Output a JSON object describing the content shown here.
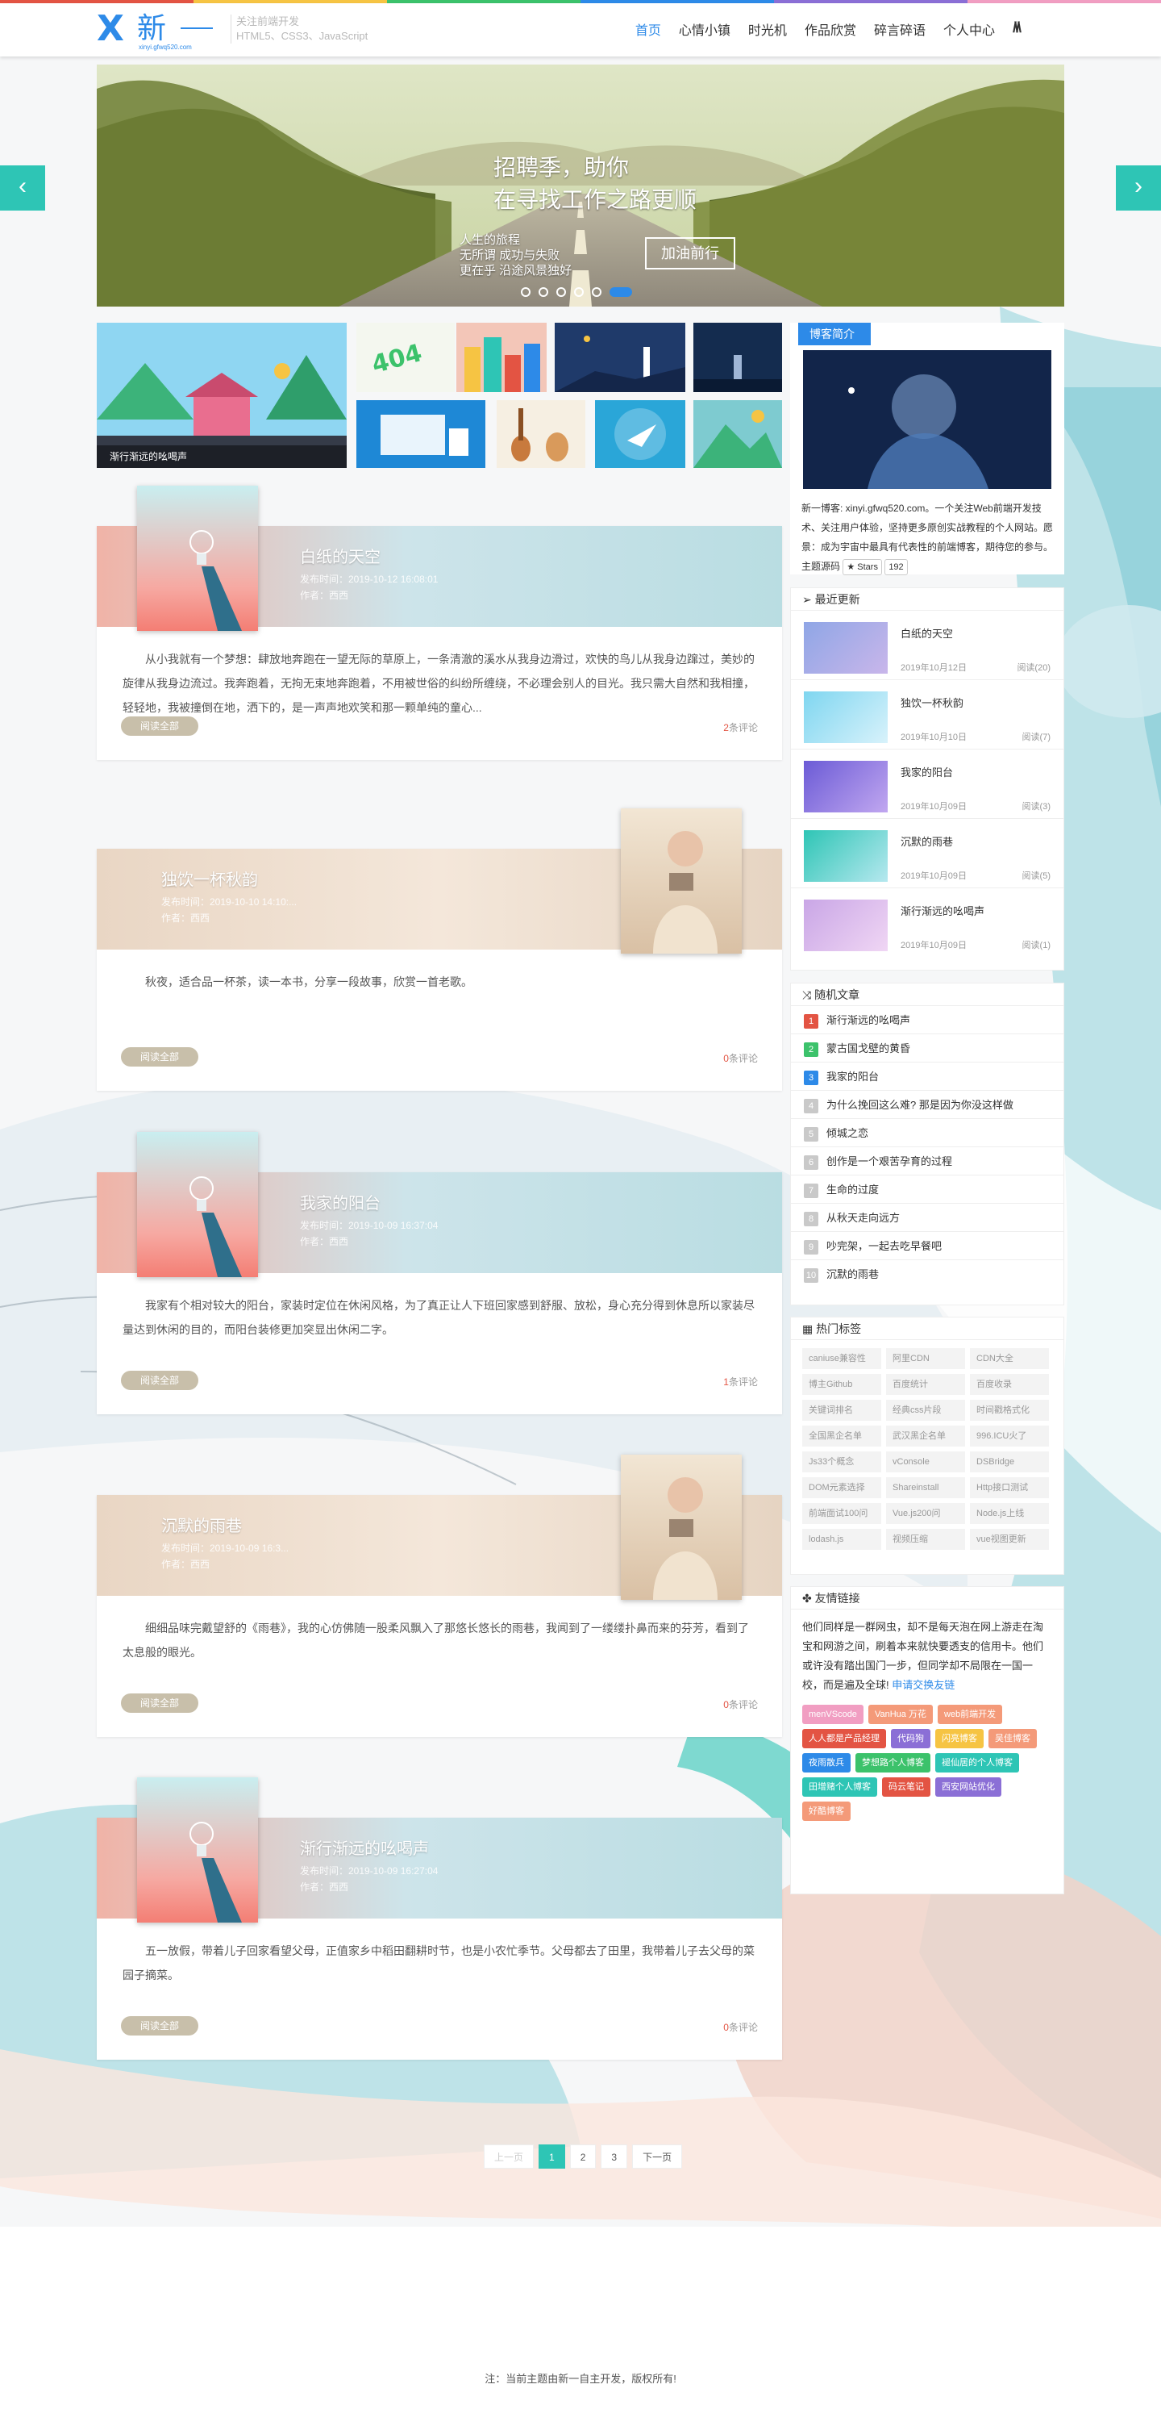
{
  "colors": {
    "accent": "#2d8ae8",
    "teal": "#2ec5b5",
    "comment_red": "#e35443"
  },
  "header": {
    "logo_x": "X",
    "logo_text": "新",
    "logo_domain": "xinyi.gfwq520.com",
    "slogan_line1": "关注前端开发",
    "slogan_line2": "HTML5、CSS3、JavaScript",
    "nav": [
      {
        "label": "首页",
        "active": true
      },
      {
        "label": "心情小镇",
        "active": false
      },
      {
        "label": "时光机",
        "active": false
      },
      {
        "label": "作品欣赏",
        "active": false
      },
      {
        "label": "碎言碎语",
        "active": false
      },
      {
        "label": "个人中心",
        "active": false
      }
    ],
    "menu_icon": "mountain-menu-icon"
  },
  "banner": {
    "headline1": "招聘季，助你",
    "headline2": "在寻找工作之路更顺",
    "sub1": "人生的旅程",
    "sub2": "无所谓 成功与失败",
    "sub3": "更在乎 沿途风景独好",
    "button": "加油前行",
    "prev": "‹",
    "next": "›",
    "slides": 6,
    "active_slide": 6
  },
  "thumbs": {
    "caption": "渐行渐远的吆喝声"
  },
  "posts": [
    {
      "title": "白纸的天空",
      "date": "发布时间：2019-10-12 16:08:01",
      "author": "作者：西西",
      "excerpt": "从小我就有一个梦想：肆放地奔跑在一望无际的草原上，一条清澈的溪水从我身边滑过，欢快的鸟儿从我身边蹿过，美妙的旋律从我身边流过。我奔跑着，无拘无束地奔跑着，不用被世俗的纠纷所缠绕，不必理会别人的目光。我只需大自然和我相撞，轻轻地，我被撞倒在地，洒下的，是一声声地欢笑和那一颗单纯的童心...",
      "read": "阅读全部",
      "comments": "2",
      "comments_label": "条评论"
    },
    {
      "title": "独饮一杯秋韵",
      "date": "发布时间：2019-10-10 14:10:...",
      "author": "作者：西西",
      "excerpt": "秋夜，适合品一杯茶，读一本书，分享一段故事，欣赏一首老歌。",
      "read": "阅读全部",
      "comments": "0",
      "comments_label": "条评论"
    },
    {
      "title": "我家的阳台",
      "date": "发布时间：2019-10-09 16:37:04",
      "author": "作者：西西",
      "excerpt": "我家有个相对较大的阳台，家装时定位在休闲风格，为了真正让人下班回家感到舒服、放松，身心充分得到休息所以家装尽量达到休闲的目的，而阳台装修更加突显出休闲二字。",
      "read": "阅读全部",
      "comments": "1",
      "comments_label": "条评论"
    },
    {
      "title": "沉默的雨巷",
      "date": "发布时间：2019-10-09 16:3...",
      "author": "作者：西西",
      "excerpt": "细细品味完戴望舒的《雨巷》，我的心仿佛随一股柔风飘入了那悠长悠长的雨巷，我闻到了一缕缕扑鼻而来的芬芳，看到了太息般的眼光。",
      "read": "阅读全部",
      "comments": "0",
      "comments_label": "条评论"
    },
    {
      "title": "渐行渐远的吆喝声",
      "date": "发布时间：2019-10-09 16:27:04",
      "author": "作者：西西",
      "excerpt": "五一放假，带着儿子回家看望父母，正值家乡中稻田翻耕时节，也是小农忙季节。父母都去了田里，我带着儿子去父母的菜园子摘菜。",
      "read": "阅读全部",
      "comments": "0",
      "comments_label": "条评论"
    }
  ],
  "sidebar": {
    "intro": {
      "title": "博客简介",
      "text": "新一博客: xinyi.gfwq520.com。一个关注Web前端开发技术、关注用户体验，坚持更多原创实战教程的个人网站。愿景：成为宇宙中最具有代表性的前端博客，期待您的参与。主题源码",
      "star_label": "Stars",
      "star_count": "192"
    },
    "recent": {
      "title": "最近更新",
      "items": [
        {
          "title": "白纸的天空",
          "date": "2019年10月12日",
          "views": "阅读(20)"
        },
        {
          "title": "独饮一杯秋韵",
          "date": "2019年10月10日",
          "views": "阅读(7)"
        },
        {
          "title": "我家的阳台",
          "date": "2019年10月09日",
          "views": "阅读(3)"
        },
        {
          "title": "沉默的雨巷",
          "date": "2019年10月09日",
          "views": "阅读(5)"
        },
        {
          "title": "渐行渐远的吆喝声",
          "date": "2019年10月09日",
          "views": "阅读(1)"
        }
      ]
    },
    "random": {
      "title": "随机文章",
      "items": [
        {
          "n": "1",
          "label": "渐行渐远的吆喝声",
          "color": "#e35443"
        },
        {
          "n": "2",
          "label": "蒙古国戈壁的黄昏",
          "color": "#3cc26b"
        },
        {
          "n": "3",
          "label": "我家的阳台",
          "color": "#2d8ae8"
        },
        {
          "n": "4",
          "label": "为什么挽回这么难? 那是因为你没这样做",
          "color": "#c9c9c9"
        },
        {
          "n": "5",
          "label": "倾城之恋",
          "color": "#c9c9c9"
        },
        {
          "n": "6",
          "label": "创作是一个艰苦孕育的过程",
          "color": "#c9c9c9"
        },
        {
          "n": "7",
          "label": "生命的过度",
          "color": "#c9c9c9"
        },
        {
          "n": "8",
          "label": "从秋天走向远方",
          "color": "#c9c9c9"
        },
        {
          "n": "9",
          "label": "吵完架，一起去吃早餐吧",
          "color": "#c9c9c9"
        },
        {
          "n": "10",
          "label": "沉默的雨巷",
          "color": "#c9c9c9"
        }
      ]
    },
    "tags": {
      "title": "热门标签",
      "items": [
        "caniuse兼容性",
        "阿里CDN",
        "CDN大全",
        "博主Github",
        "百度统计",
        "百度收录",
        "关键词排名",
        "经典css片段",
        "时间戳格式化",
        "全国黑企名单",
        "武汉黑企名单",
        "996.ICU火了",
        "Js33个概念",
        "vConsole",
        "DSBridge",
        "DOM元素选择",
        "Shareinstall",
        "Http接口测试",
        "前端面试100问",
        "Vue.js200问",
        "Node.js上线",
        "lodash.js",
        "视频压缩",
        "vue视图更新"
      ]
    },
    "links": {
      "title": "友情链接",
      "text": "他们同样是一群网虫，却不是每天泡在网上游走在淘宝和网游之间，刷着本来就快要透支的信用卡。他们或许没有踏出国门一步，但同学却不局限在一国一校，而是遍及全球!",
      "apply": "申请交换友链",
      "pills": [
        {
          "label": "menVScode",
          "color": "#f19ec2"
        },
        {
          "label": "VanHua 万花",
          "color": "#f49a79"
        },
        {
          "label": "web前端开发",
          "color": "#f49a79"
        },
        {
          "label": "人人都是产品经理",
          "color": "#e35443"
        },
        {
          "label": "代码狗",
          "color": "#8b6fd6"
        },
        {
          "label": "闪亮博客",
          "color": "#f6c443"
        },
        {
          "label": "吴佳博客",
          "color": "#f49a79"
        },
        {
          "label": "夜雨散兵",
          "color": "#2d8ae8"
        },
        {
          "label": "梦想路个人博客",
          "color": "#3cc26b"
        },
        {
          "label": "褪仙居的个人博客",
          "color": "#2ec5b5"
        },
        {
          "label": "田增赌个人博客",
          "color": "#2ec5b5"
        },
        {
          "label": "码云笔记",
          "color": "#e35443"
        },
        {
          "label": "西安网站优化",
          "color": "#8b6fd6"
        },
        {
          "label": "好酷博客",
          "color": "#f49a79"
        }
      ]
    }
  },
  "pagination": {
    "prev": "上一页",
    "pages": [
      "1",
      "2",
      "3"
    ],
    "current": "1",
    "next": "下一页"
  },
  "footer": {
    "text": "注：当前主题由新一自主开发，版权所有!"
  }
}
